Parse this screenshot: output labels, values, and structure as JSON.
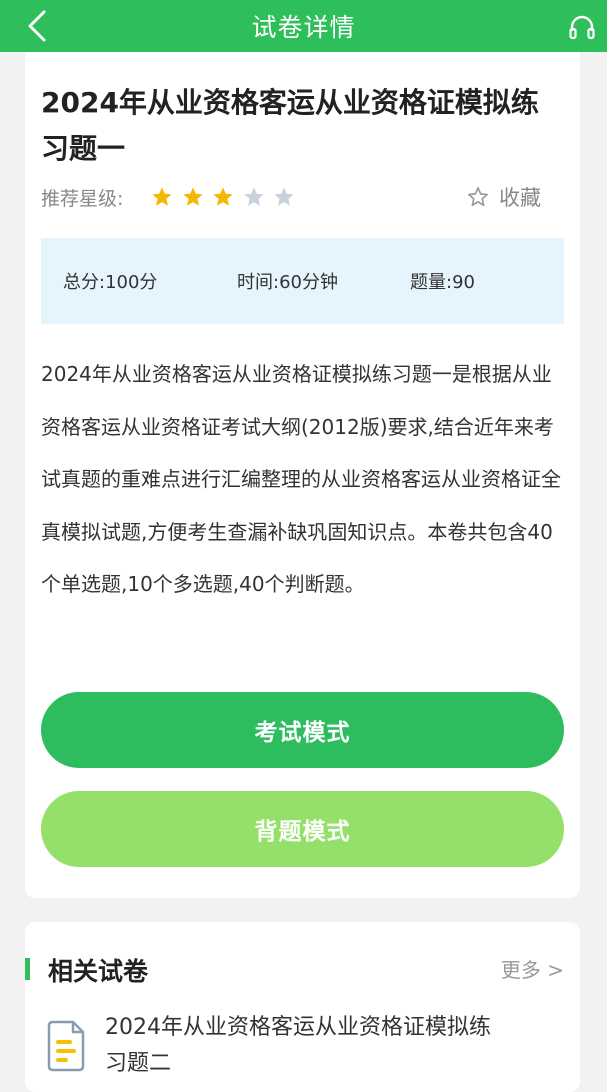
{
  "header": {
    "title": "试卷详情"
  },
  "paper": {
    "title": "2024年从业资格客运从业资格证模拟练习题一",
    "stars_label": "推荐星级:",
    "rating": 3,
    "rating_max": 5,
    "favorite_label": "收藏",
    "total_score": "总分:100分",
    "time": "时间:60分钟",
    "count": "题量:90",
    "description": "2024年从业资格客运从业资格证模拟练习题一是根据从业资格客运从业资格证考试大纲(2012版)要求,结合近年来考试真题的重难点进行汇编整理的从业资格客运从业资格证全真模拟试题,方便考生查漏补缺巩固知识点。本卷共包含40个单选题,10个多选题,40个判断题。"
  },
  "buttons": {
    "exam_mode": "考试模式",
    "study_mode": "背题模式"
  },
  "related": {
    "title": "相关试卷",
    "more": "更多 >",
    "items": [
      {
        "title": "2024年从业资格客运从业资格证模拟练习题二"
      }
    ]
  },
  "colors": {
    "brand": "#2fbf5a",
    "star_on": "#f5b800",
    "star_off": "#c9d2dc",
    "info_bg": "#e5f4fd",
    "btn_exam": "#2dbd5f",
    "btn_study": "#94e06a"
  },
  "icons": {
    "back": "chevron-left-icon",
    "headset": "headset-icon",
    "star": "star-icon",
    "favorite": "star-outline-icon",
    "doc": "document-icon"
  }
}
